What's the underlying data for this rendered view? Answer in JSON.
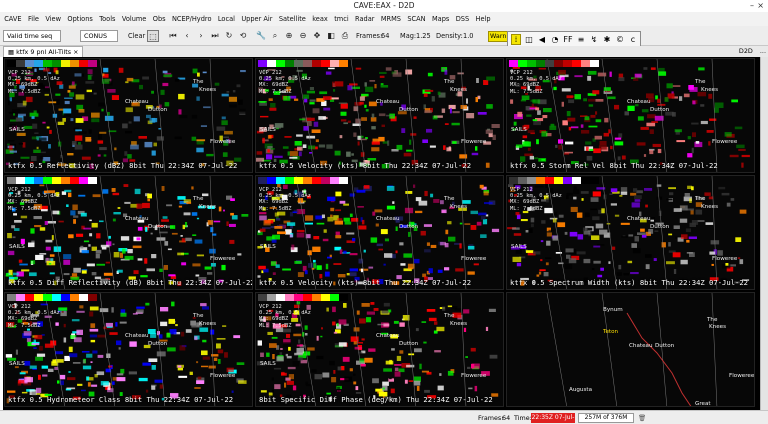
{
  "window": {
    "title": "CAVE:EAX - D2D"
  },
  "menus": [
    "CAVE",
    "File",
    "View",
    "Options",
    "Tools",
    "Volume",
    "Obs",
    "NCEP/Hydro",
    "Local",
    "Upper Air",
    "Satellite",
    "keax",
    "tmci",
    "Radar",
    "MRMS",
    "SCAN",
    "Maps",
    "DSS",
    "Help"
  ],
  "toolbar": {
    "time_mode": "Valid time seq",
    "scale": "CONUS",
    "clear_label": "Clear",
    "frames_label": "Frames:",
    "frames_value": "64",
    "mag_label": "Mag:",
    "mag_value": "1.25",
    "density_label": "Density:",
    "density_value": "1.0",
    "warn_label": "Warn"
  },
  "tabs": {
    "active": "ktfx 9 pnl All-Tilts",
    "right": [
      "D2D",
      "..."
    ]
  },
  "panels": [
    {
      "id": "reflectivity",
      "label": "ktfx 0.5 Reflectivity (dBZ) 8bit  Thu 22:34Z 07-Jul-22",
      "colorbar": [
        "#000000",
        "#3a3a3a",
        "#5a8fd0",
        "#25a5e8",
        "#00c000",
        "#009000",
        "#f0f000",
        "#f09000",
        "#f00000",
        "#c00080"
      ]
    },
    {
      "id": "velocity",
      "label": "ktfx 0.5 Velocity (kts) 8bit  Thu 22:34Z 07-Jul-22",
      "colorbar": [
        "#8000ff",
        "#ffffff",
        "#00ff00",
        "#008000",
        "#5c6e5c",
        "#8a5a5a",
        "#b00000",
        "#ff0000",
        "#ffb0b0",
        "#ff8000"
      ]
    },
    {
      "id": "srv",
      "label": "ktfx 0.5 Storm Rel Vel 8bit  Thu 22:34Z 07-Jul-22",
      "colorbar": [
        "#ff00ff",
        "#00ff00",
        "#00c000",
        "#008000",
        "#404040",
        "#800000",
        "#c00000",
        "#ff0000",
        "#ff8080",
        "#ffffff"
      ]
    },
    {
      "id": "zdr",
      "label": "ktfx 0.5 Diff Reflectivity (dB) 8bit  Thu 22:34Z 07-Jul-22",
      "colorbar": [
        "#808080",
        "#ffffff",
        "#00ffff",
        "#0080ff",
        "#00ff00",
        "#ffff00",
        "#ff8000",
        "#ff0000",
        "#ff00ff",
        "#ffffff"
      ]
    },
    {
      "id": "cc",
      "label": "ktfx 0.5 Velocity (kts) 8bit  Thu 22:34Z 07-Jul-22",
      "colorbar": [
        "#202060",
        "#0000ff",
        "#00ffff",
        "#00ff00",
        "#ffff00",
        "#ff8000",
        "#ff0000",
        "#c00060",
        "#ff80ff",
        "#ffffff"
      ]
    },
    {
      "id": "sw",
      "label": "ktfx 0.5 Spectrum Width (kts) 8bit  Thu 22:34Z 07-Jul-22",
      "colorbar": [
        "#303030",
        "#606060",
        "#909090",
        "#ff8000",
        "#ff0000",
        "#ffff00",
        "#8000ff",
        "#ffffff",
        "#000000",
        "#000000"
      ]
    },
    {
      "id": "hc",
      "label": "ktfx 0.5 Hydrometeor Class 8bit  Thu 22:34Z 07-Jul-22",
      "colorbar": [
        "#808080",
        "#ff80ff",
        "#ff0000",
        "#ffff00",
        "#00ff00",
        "#00ffff",
        "#0000ff",
        "#ff8000",
        "#ffffff",
        "#800000"
      ]
    },
    {
      "id": "kdp",
      "label": "8bit Specific Diff Phase (deg/km)  Thu 22:34Z 07-Jul-22",
      "colorbar": [
        "#404040",
        "#a0a0a0",
        "#ffffff",
        "#ff80c0",
        "#ff0080",
        "#ff0000",
        "#ff8000",
        "#ffff00",
        "#00ff00",
        "#000000"
      ]
    },
    {
      "id": "map",
      "label": "",
      "colorbar": []
    }
  ],
  "info_lines": [
    "VCP 212",
    "0.25 km, 0.5 dAz",
    "MX: 69dBZ",
    "ML: 7.5dBZ"
  ],
  "cities": {
    "c1": "The",
    "c2": "Knees",
    "c3": "Dutton",
    "c4": "Chateau",
    "c5": "Floweree",
    "c6": "SAILS",
    "c7": "Teton",
    "c8": "Bynum",
    "c9": "Augusta",
    "c10": "Great"
  },
  "status": {
    "frames_label": "Frames:",
    "frames_value": "64",
    "time_label": "Time:",
    "time_value": "22:35Z 07-Jul-22",
    "memory": "257M of 376M"
  },
  "colors": {
    "accent_warn": "#f5e600",
    "time_bg": "#e02020"
  }
}
